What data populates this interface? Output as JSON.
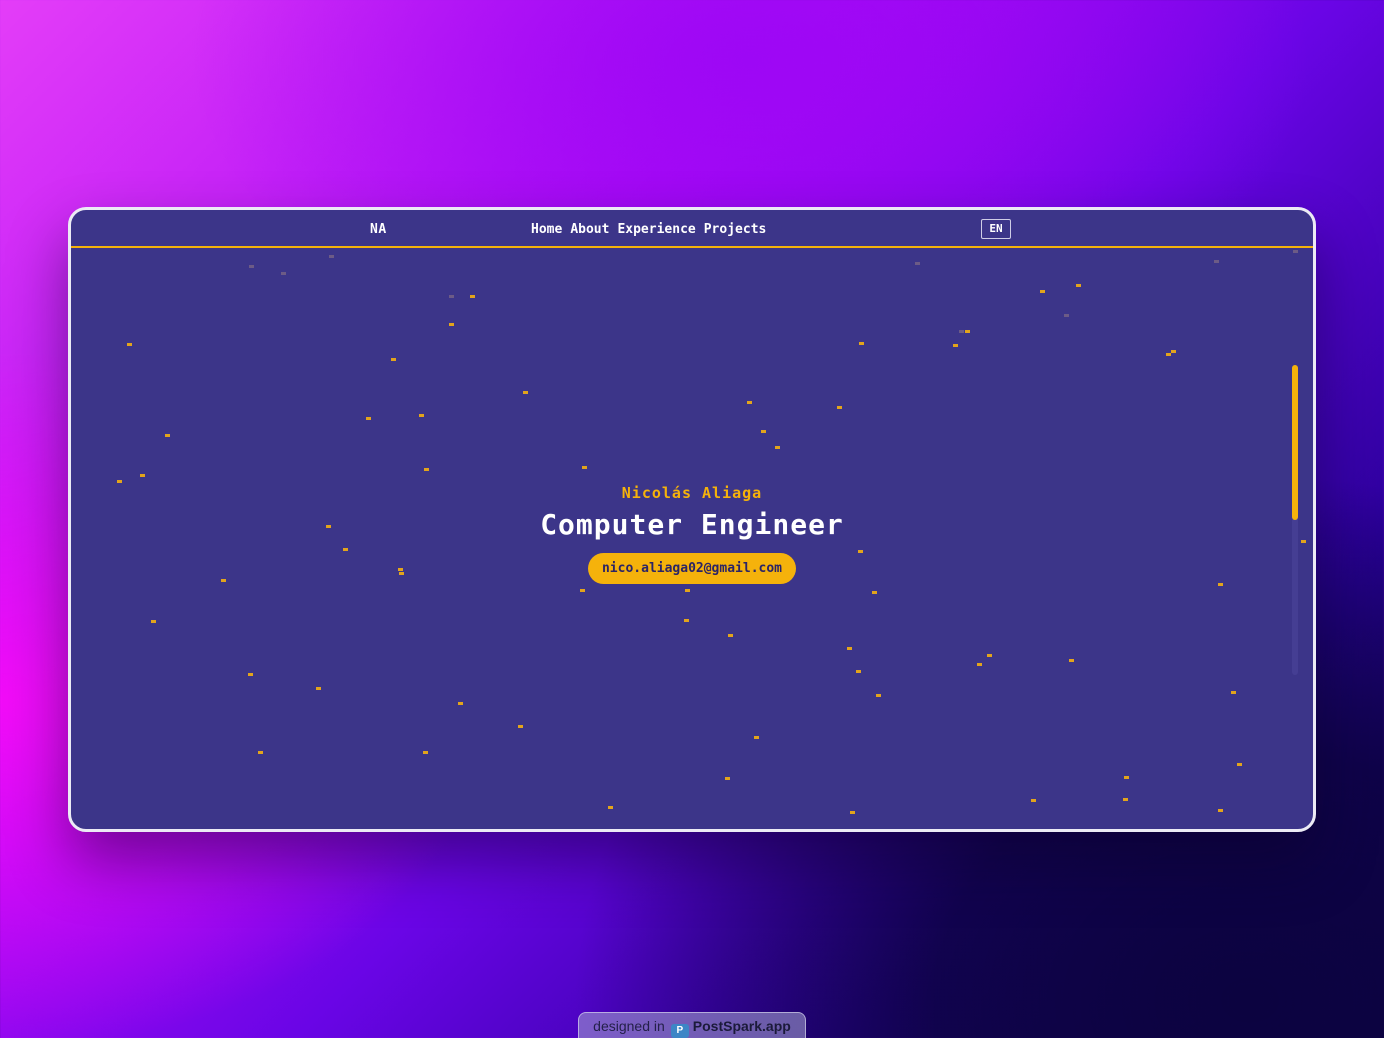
{
  "nav": {
    "brand": "NA",
    "items": [
      "Home",
      "About",
      "Experience",
      "Projects"
    ],
    "lang": "EN"
  },
  "hero": {
    "name": "Nicolás Aliaga",
    "title": "Computer Engineer",
    "email": "nico.aliaga02@gmail.com"
  },
  "badge": {
    "prefix": "designed in",
    "app": "PostSpark.app"
  },
  "colors": {
    "accent": "#f5b20b",
    "page_background": "#3c3589",
    "text": "#ffffff"
  }
}
